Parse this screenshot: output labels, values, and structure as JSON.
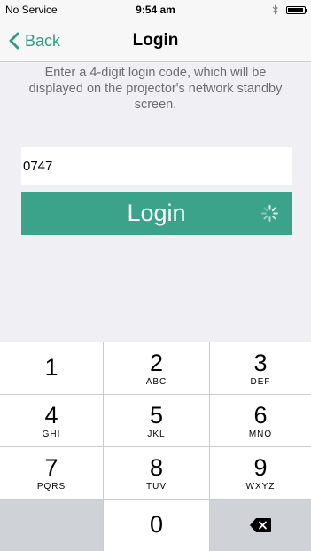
{
  "status_bar": {
    "carrier": "No Service",
    "time": "9:54 am",
    "icons": [
      "bluetooth-icon",
      "battery-icon"
    ]
  },
  "nav": {
    "back_label": "Back",
    "title": "Login"
  },
  "instructions": "Enter a 4-digit login code, which will be displayed on the projector's network standby screen.",
  "code_input": {
    "value": "0747"
  },
  "login_button": {
    "label": "Login",
    "loading": true
  },
  "colors": {
    "accent": "#3aa38a",
    "nav_tint": "#2f9e85"
  },
  "keypad": {
    "keys": [
      {
        "num": "1",
        "letters": ""
      },
      {
        "num": "2",
        "letters": "ABC"
      },
      {
        "num": "3",
        "letters": "DEF"
      },
      {
        "num": "4",
        "letters": "GHI"
      },
      {
        "num": "5",
        "letters": "JKL"
      },
      {
        "num": "6",
        "letters": "MNO"
      },
      {
        "num": "7",
        "letters": "PQRS"
      },
      {
        "num": "8",
        "letters": "TUV"
      },
      {
        "num": "9",
        "letters": "WXYZ"
      },
      {
        "num": "0",
        "letters": ""
      }
    ],
    "delete_icon": "backspace-icon"
  }
}
